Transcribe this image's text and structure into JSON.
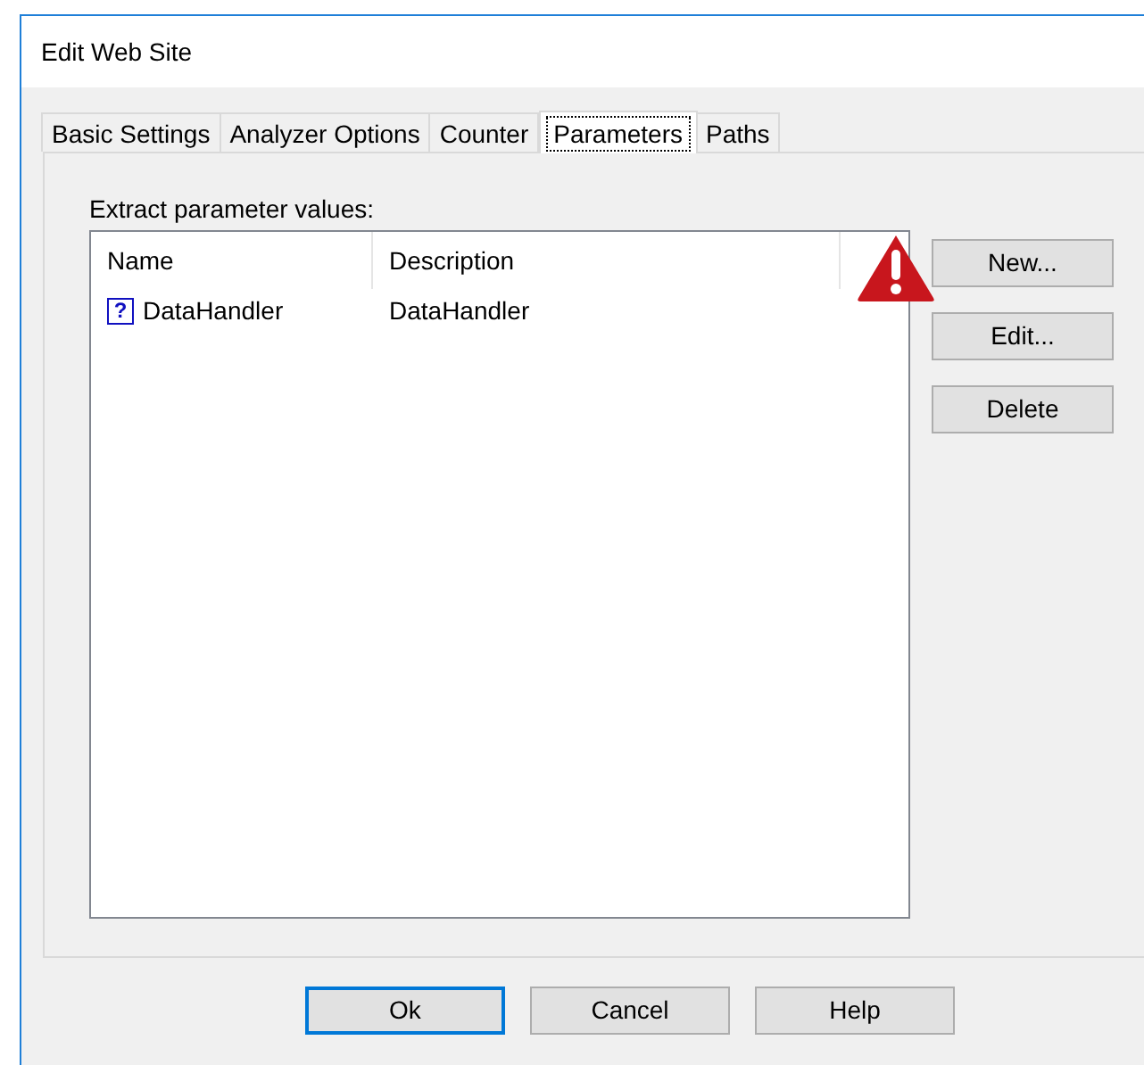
{
  "window": {
    "title": "Edit Web Site"
  },
  "tabs": [
    {
      "label": "Basic Settings",
      "selected": false
    },
    {
      "label": "Analyzer Options",
      "selected": false
    },
    {
      "label": "Counter",
      "selected": false
    },
    {
      "label": "Parameters",
      "selected": true
    },
    {
      "label": "Paths",
      "selected": false
    }
  ],
  "list_label": "Extract parameter values:",
  "table": {
    "columns": [
      "Name",
      "Description"
    ],
    "rows": [
      {
        "name": "DataHandler",
        "description": "DataHandler",
        "icon": "?"
      }
    ]
  },
  "side_buttons": [
    "New...",
    "Edit...",
    "Delete"
  ],
  "footer_buttons": [
    {
      "label": "Ok",
      "default": true
    },
    {
      "label": "Cancel",
      "default": false
    },
    {
      "label": "Help",
      "default": false
    }
  ]
}
